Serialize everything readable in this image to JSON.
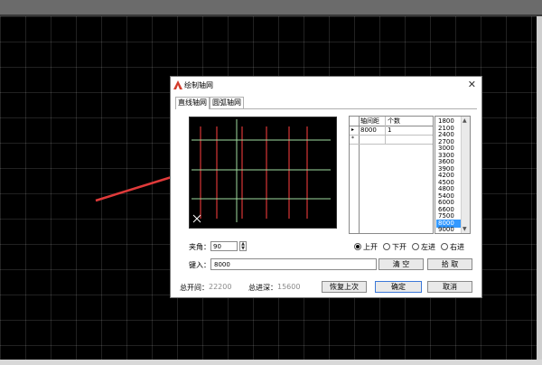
{
  "dialog": {
    "title": "绘制轴网",
    "close_glyph": "✕",
    "tabs": [
      {
        "label": "直线轴网",
        "active": true
      },
      {
        "label": "圆弧轴网",
        "active": false
      }
    ]
  },
  "grid_table": {
    "headers": [
      "轴间距",
      "个数"
    ],
    "rows": [
      {
        "marker": "▸",
        "spacing": "8000",
        "count": "1"
      },
      {
        "marker": "*",
        "spacing": "",
        "count": ""
      }
    ]
  },
  "spacing_list": {
    "items": [
      "1800",
      "2100",
      "2400",
      "2700",
      "3000",
      "3300",
      "3600",
      "3900",
      "4200",
      "4500",
      "4800",
      "5400",
      "6000",
      "6600",
      "7500",
      "8000",
      "9000"
    ],
    "selected": "8000"
  },
  "angle": {
    "label": "夹角：",
    "value": "90"
  },
  "direction_options": [
    {
      "label": "上开",
      "checked": true
    },
    {
      "label": "下开",
      "checked": false
    },
    {
      "label": "左进",
      "checked": false
    },
    {
      "label": "右进",
      "checked": false
    }
  ],
  "input": {
    "label": "键入：",
    "value": "8000"
  },
  "buttons": {
    "clear": "清  空",
    "pick": "拾  取",
    "restore": "恢复上次",
    "ok": "确定",
    "cancel": "取消"
  },
  "summary": {
    "total_open_label": "总开间：",
    "total_open_value": "22200",
    "total_depth_label": "总进深：",
    "total_depth_value": "15600"
  },
  "colors": {
    "axis_red": "#c83232",
    "axis_green": "#9fdc9f",
    "arrow": "#e03a3a",
    "accent": "#3399ff"
  }
}
